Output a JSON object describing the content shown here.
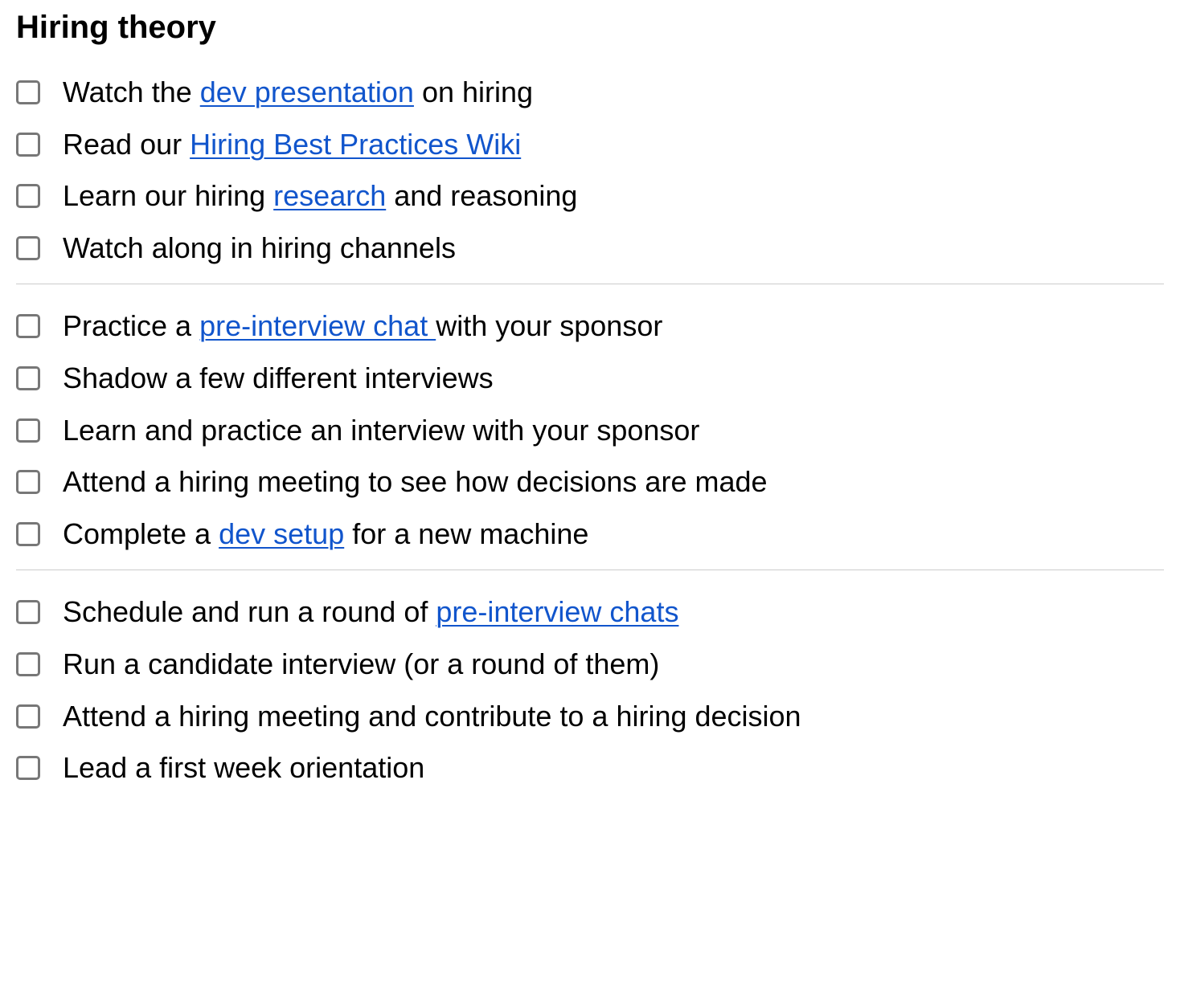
{
  "heading": "Hiring theory",
  "sections": [
    {
      "items": [
        {
          "parts": [
            {
              "text": "Watch the "
            },
            {
              "text": "dev presentation",
              "link": true
            },
            {
              "text": " on hiring"
            }
          ]
        },
        {
          "parts": [
            {
              "text": "Read our "
            },
            {
              "text": "Hiring Best Practices Wiki",
              "link": true
            }
          ]
        },
        {
          "parts": [
            {
              "text": "Learn our hiring "
            },
            {
              "text": "research",
              "link": true
            },
            {
              "text": " and reasoning"
            }
          ]
        },
        {
          "parts": [
            {
              "text": "Watch along in hiring channels"
            }
          ]
        }
      ]
    },
    {
      "items": [
        {
          "parts": [
            {
              "text": "Practice a "
            },
            {
              "text": "pre-interview chat ",
              "link": true
            },
            {
              "text": "with your sponsor"
            }
          ]
        },
        {
          "parts": [
            {
              "text": "Shadow a few different interviews"
            }
          ]
        },
        {
          "parts": [
            {
              "text": "Learn and practice an interview with your sponsor"
            }
          ]
        },
        {
          "parts": [
            {
              "text": "Attend a hiring meeting to see how decisions are made"
            }
          ]
        },
        {
          "parts": [
            {
              "text": "Complete a "
            },
            {
              "text": "dev setup",
              "link": true
            },
            {
              "text": " for a new machine"
            }
          ]
        }
      ]
    },
    {
      "items": [
        {
          "parts": [
            {
              "text": "Schedule and run a round of "
            },
            {
              "text": "pre-interview chats",
              "link": true
            }
          ]
        },
        {
          "parts": [
            {
              "text": "Run a candidate interview (or a round of them)"
            }
          ]
        },
        {
          "parts": [
            {
              "text": "Attend a hiring meeting and contribute to a hiring decision"
            }
          ]
        },
        {
          "parts": [
            {
              "text": "Lead a first week orientation"
            }
          ]
        }
      ]
    }
  ]
}
